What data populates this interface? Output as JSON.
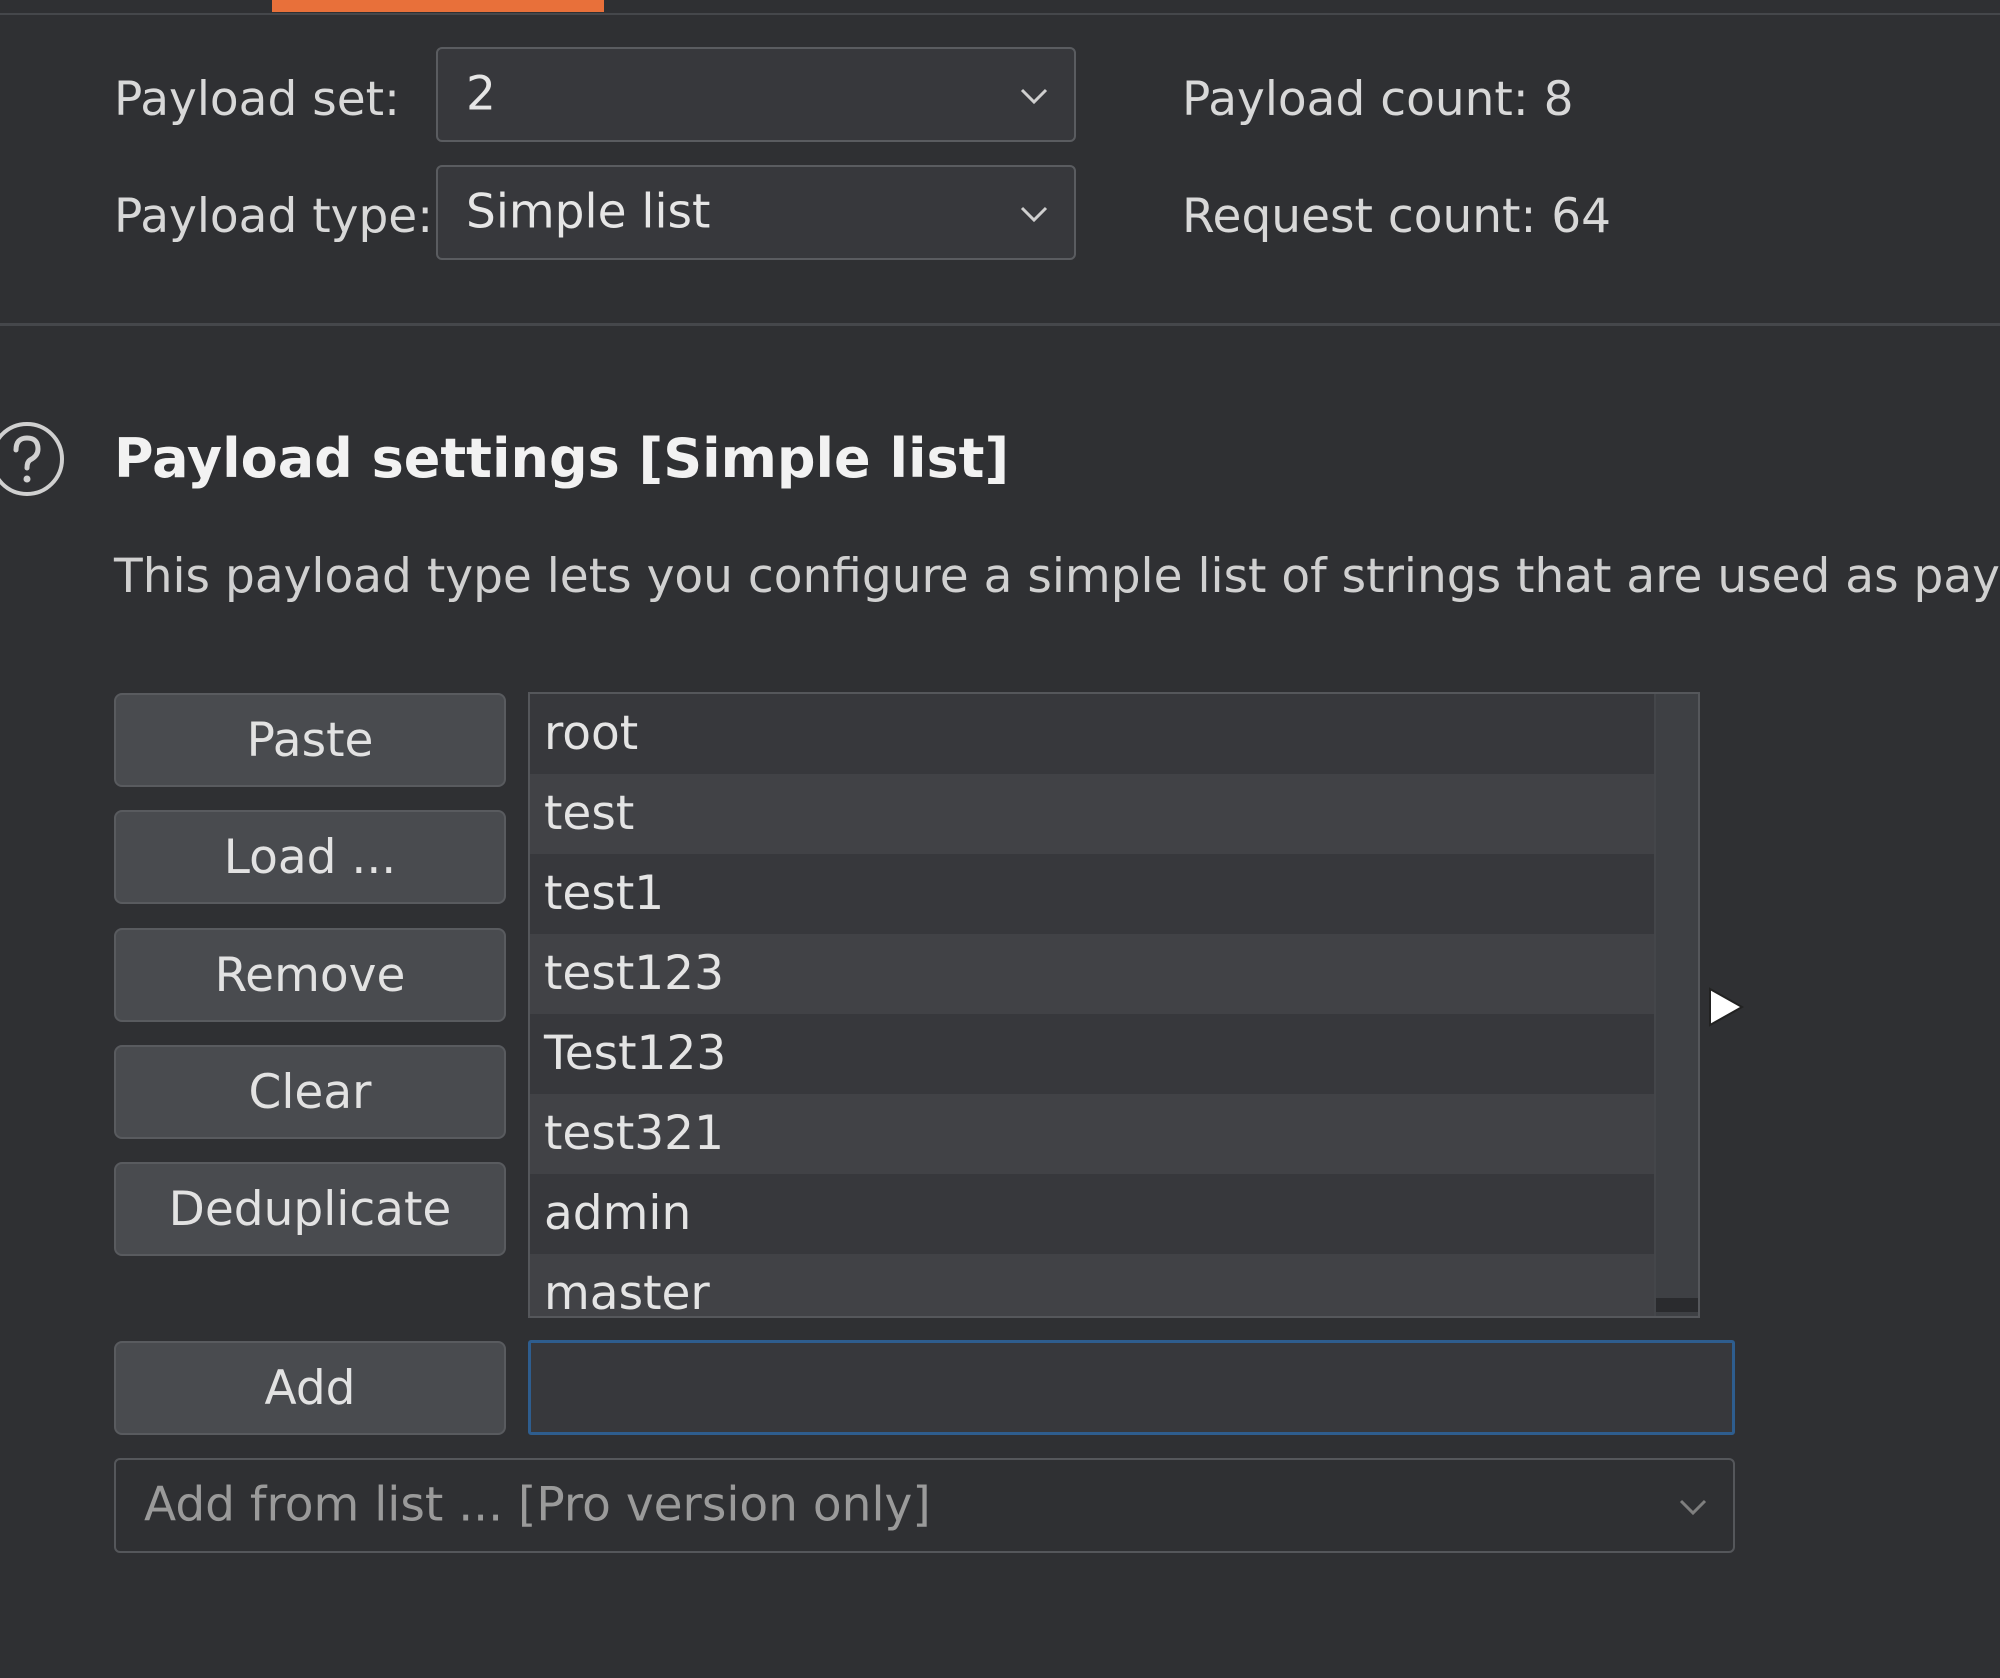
{
  "top": {
    "payload_set_label": "Payload set:",
    "payload_set_value": "2",
    "payload_type_label": "Payload type:",
    "payload_type_value": "Simple list",
    "payload_count_label": "Payload count: 8",
    "request_count_label": "Request count: 64"
  },
  "settings": {
    "title": "Payload settings [Simple list]",
    "description": "This payload type lets you configure a simple list of strings that are used as payload"
  },
  "buttons": {
    "paste": "Paste",
    "load": "Load ...",
    "remove": "Remove",
    "clear": "Clear",
    "deduplicate": "Deduplicate",
    "add": "Add"
  },
  "payload_list": [
    "root",
    "test",
    "test1",
    "test123",
    "Test123",
    "test321",
    "admin",
    "master"
  ],
  "add_input": {
    "value": ""
  },
  "add_from_list": {
    "value": "Add from list ... [Pro version only]"
  },
  "colors": {
    "accent_tab": "#e8703a",
    "focus_border": "#2e5d8e",
    "background": "#2f3033"
  }
}
